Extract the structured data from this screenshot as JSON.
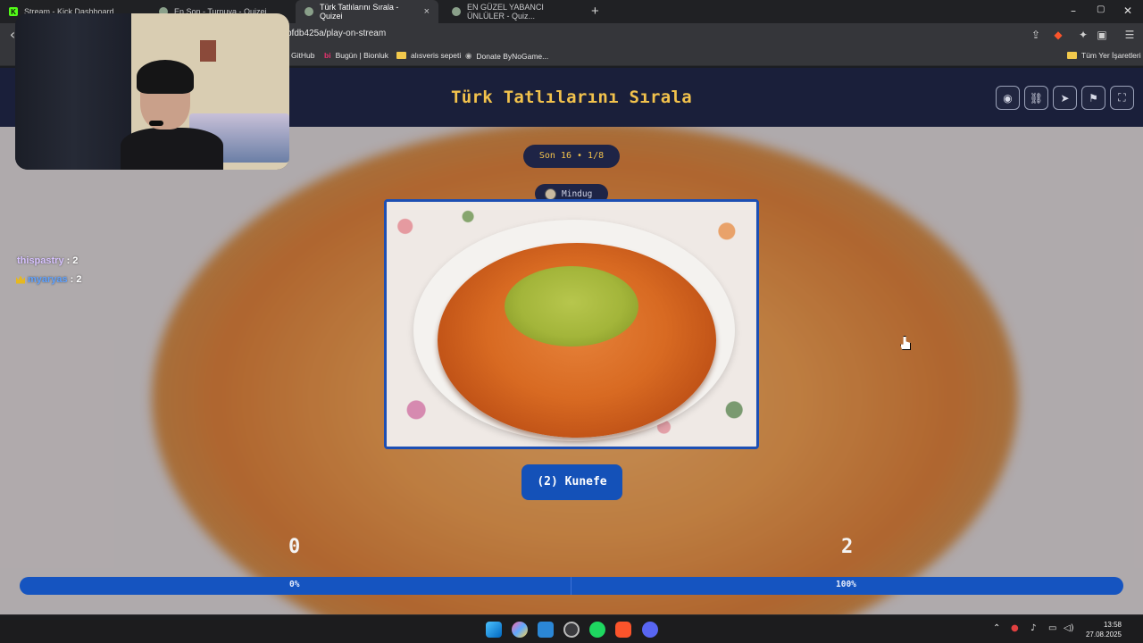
{
  "browser": {
    "tabs": [
      {
        "label": "Stream - Kick Dashboard",
        "favicon_color": "#53fc18",
        "favicon_letter": "K"
      },
      {
        "label": "En Son - Turnuva - Quizei",
        "favicon_color": "#8aa08a",
        "favicon_letter": ""
      },
      {
        "label": "Türk Tatlılarını Sırala - Quizei",
        "favicon_color": "#8aa08a",
        "favicon_letter": ""
      },
      {
        "label": "EN GÜZEL YABANCI ÜNLÜLER - Quiz...",
        "favicon_color": "#8aa08a",
        "favicon_letter": ""
      }
    ],
    "tab_close": "×",
    "new_tab": "+",
    "window_controls": {
      "minimize": "–",
      "maximize": "▢",
      "close": "✕"
    },
    "url": "bfdb425a/play-on-stream",
    "back_icon": "‹",
    "bookmarks": [
      {
        "label": "GitHub"
      },
      {
        "label": "Bugün | Bionluk"
      },
      {
        "label": "alısveris sepeti"
      },
      {
        "label": "Donate ByNoGame..."
      }
    ],
    "all_bookmarks": "Tüm Yer İşaretleri"
  },
  "quiz": {
    "title": "Türk Tatlılarını Sırala",
    "round_pill": "Son 16 • 1/8",
    "author": "Mindug",
    "answer_label": "(2) Kunefe",
    "score_left": "0",
    "score_right": "2",
    "percent_left": "0%",
    "percent_right": "100%",
    "header_buttons": [
      "eye-icon",
      "link-icon",
      "send-icon",
      "flag-icon",
      "fullscreen-icon"
    ]
  },
  "chat": [
    {
      "user": "thispastry",
      "count": "2",
      "color": "#d7c2ff",
      "crown": false
    },
    {
      "user": "myaryas",
      "count": "2",
      "color": "#5fa2ff",
      "crown": true
    }
  ],
  "system": {
    "time": "13:58",
    "date": "27.08.2025"
  }
}
